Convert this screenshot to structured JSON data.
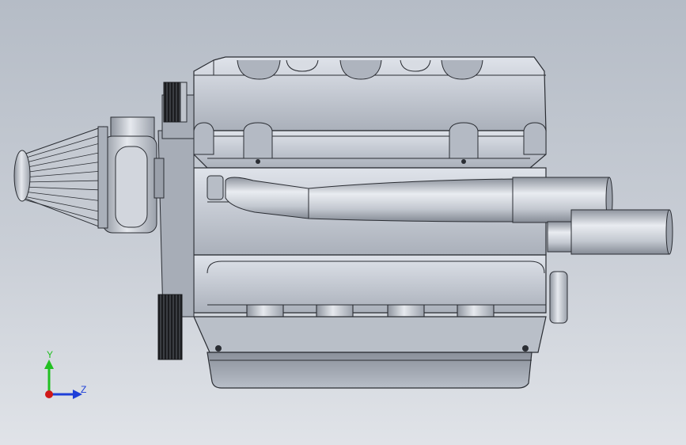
{
  "viewport": {
    "background_top": "#b5bcc6",
    "background_bottom": "#e0e3e8",
    "part_color": "#c7ccd6",
    "edge_color": "#2a2d33"
  },
  "triad": {
    "y_label": "Y",
    "z_label": "Z",
    "y_color": "#22c022",
    "z_color": "#1e3fd8",
    "x_color": "#d01818"
  },
  "model": {
    "name": "engine-assembly",
    "icon": "engine-model"
  }
}
